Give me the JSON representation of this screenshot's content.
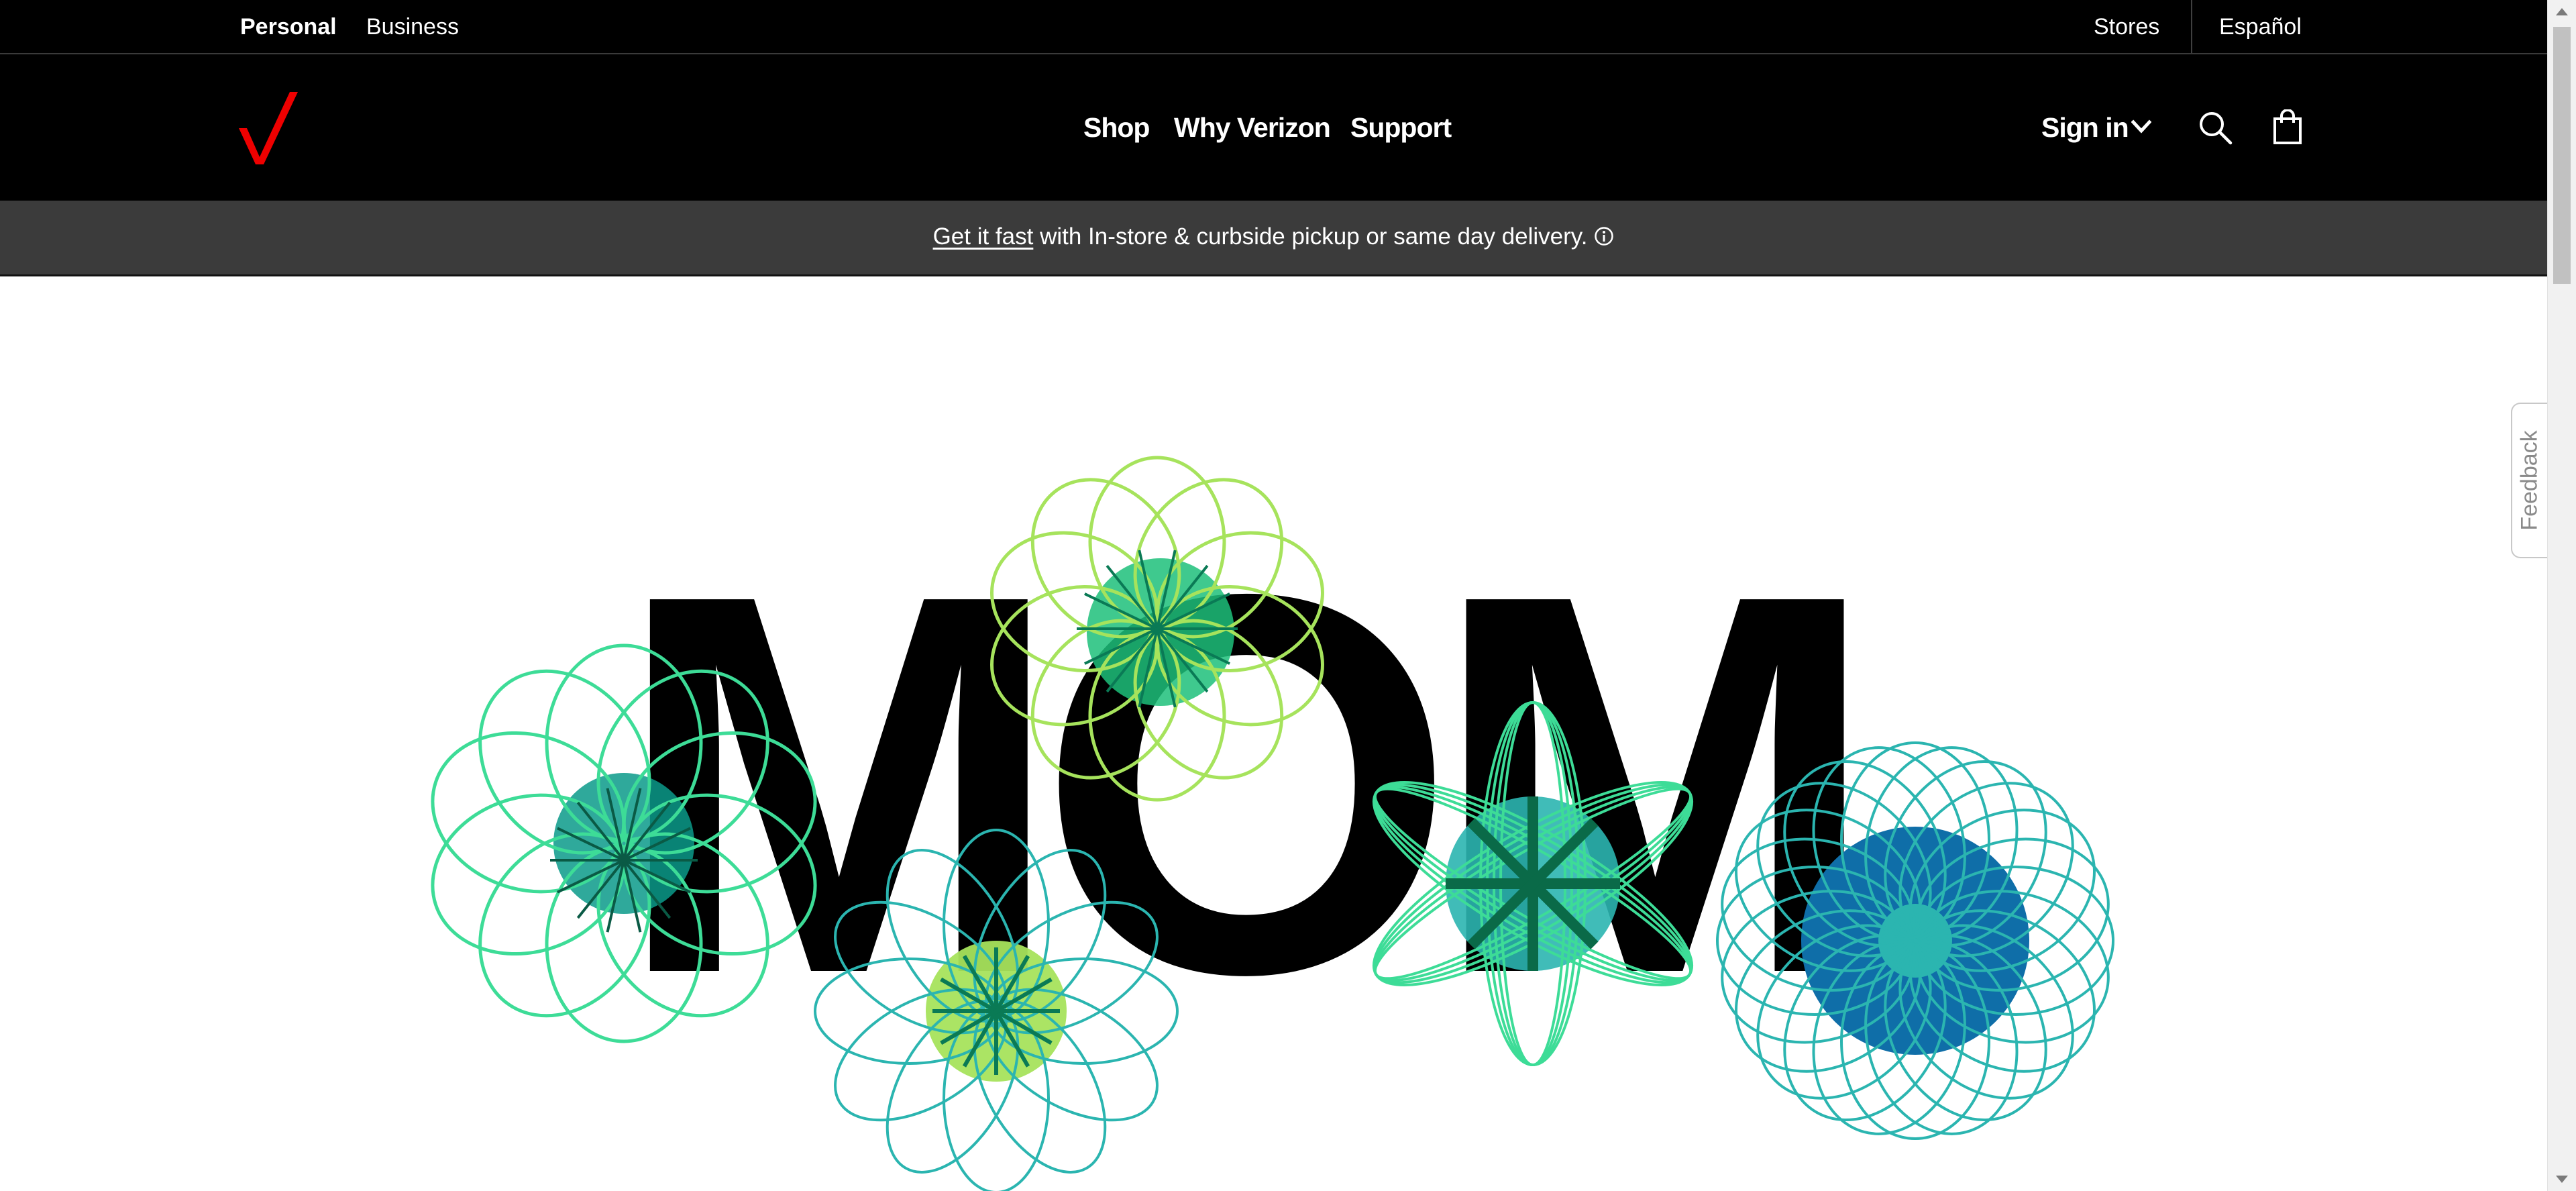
{
  "utility_bar": {
    "personal_label": "Personal",
    "business_label": "Business",
    "stores_label": "Stores",
    "espanol_label": "Español"
  },
  "main_nav": {
    "logo_icon": "verizon-checkmark-icon",
    "shop_label": "Shop",
    "why_label": "Why Verizon",
    "support_label": "Support",
    "signin_label": "Sign in",
    "chevron_icon": "chevron-down-icon",
    "search_icon": "search-icon",
    "cart_icon": "shopping-bag-icon"
  },
  "promo": {
    "link_label": "Get it fast",
    "text": " with In-store & curbside pickup or same day delivery.",
    "info_icon": "info-icon"
  },
  "hero": {
    "headline": "MOM",
    "decoration": "spirograph-flowers"
  },
  "feedback": {
    "label": "Feedback"
  },
  "colors": {
    "brand_red": "#ee0000",
    "nav_background": "#000000",
    "promo_background": "#3b3b3b",
    "flower_teal": "#2bb5b0",
    "flower_mint": "#3ddc97",
    "flower_lime": "#a6e35c",
    "flower_blue": "#0f6ea8",
    "flower_dark_green": "#0a7a55"
  }
}
